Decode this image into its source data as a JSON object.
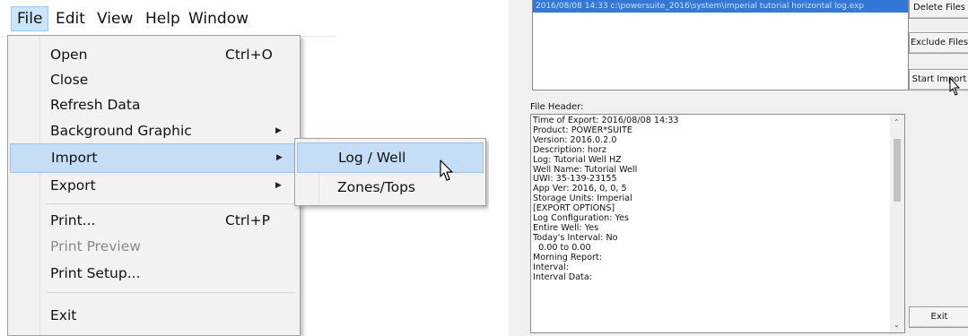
{
  "menubar": {
    "items": [
      {
        "label": "File"
      },
      {
        "label": "Edit"
      },
      {
        "label": "View"
      },
      {
        "label": "Help"
      },
      {
        "label": "Window"
      }
    ]
  },
  "file_menu": {
    "open": {
      "label": "Open",
      "shortcut": "Ctrl+O"
    },
    "close": {
      "label": "Close"
    },
    "refresh": {
      "label": "Refresh Data"
    },
    "background": {
      "label": "Background Graphic"
    },
    "import": {
      "label": "Import"
    },
    "export": {
      "label": "Export"
    },
    "print": {
      "label": "Print...",
      "shortcut": "Ctrl+P"
    },
    "print_preview": {
      "label": "Print Preview"
    },
    "print_setup": {
      "label": "Print Setup..."
    },
    "exit": {
      "label": "Exit"
    }
  },
  "import_submenu": {
    "log_well": "Log / Well",
    "zones_tops": "Zones/Tops"
  },
  "dialog": {
    "file_row": "2016/08/08 14:33    c:\\powersuite_2016\\system\\imperial tutorial horizontal log.exp",
    "buttons": {
      "delete_files": "Delete Files",
      "exclude_files": "Exclude Files",
      "start_import": "Start Import",
      "exit": "Exit"
    },
    "file_header_label": "File Header:",
    "file_header_text": "Time of Export: 2016/08/08 14:33\nProduct: POWER*SUITE\nVersion: 2016.0.2.0\nDescription: horz\nLog: Tutorial Well HZ\nWell Name: Tutorial Well\nUWI: 35-139-23155\nApp Ver: 2016, 0, 0, 5\nStorage Units: Imperial\n[EXPORT OPTIONS]\nLog Configuration: Yes\nEntire Well: Yes\nToday's Interval: No\n  0.00 to 0.00\nMorning Report:\nInterval:\nInterval Data:"
  },
  "colors": {
    "menu_highlight": "#c5ddf5",
    "selection_blue": "#3478d6"
  }
}
